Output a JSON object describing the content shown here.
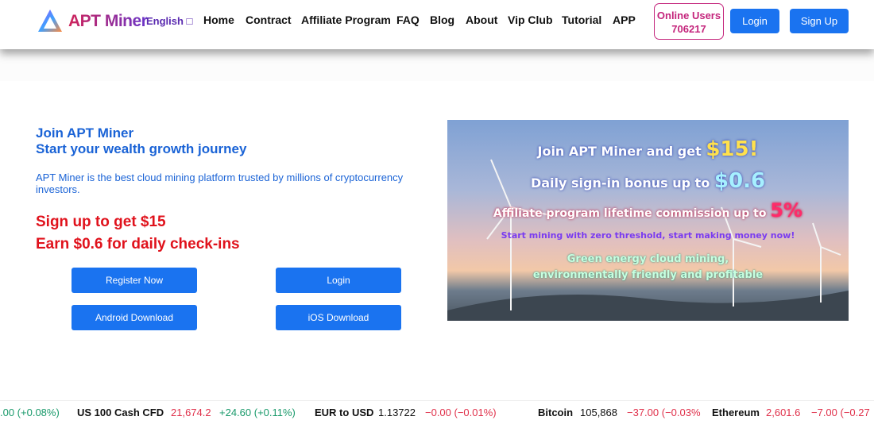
{
  "header": {
    "logo": "APT Miner",
    "language": "English □",
    "nav": [
      "Home",
      "Contract",
      "Affiliate Program",
      "FAQ",
      "Blog",
      "About",
      "Vip Club",
      "Tutorial",
      "APP"
    ],
    "online_label": "Online Users",
    "online_count": "706217",
    "login": "Login",
    "signup": "Sign Up"
  },
  "hero": {
    "title1": "Join APT Miner",
    "title2": "Start your wealth growth journey",
    "description": "APT Miner is the best cloud mining platform trusted by millions of cryptocurrency investors.",
    "promo1": "Sign up to get $15",
    "promo2": "Earn $0.6 for daily check-ins",
    "buttons": {
      "register": "Register Now",
      "login": "Login",
      "android": "Android Download",
      "ios": "iOS Download"
    }
  },
  "banner": {
    "line1": "Join APT Miner and get",
    "line1_amount": "$15!",
    "line2": "Daily sign-in bonus up to",
    "line2_amount": "$0.6",
    "line3": "Affiliate program lifetime commission up to",
    "line3_amount": "5%",
    "line4": "Start mining with zero threshold, start making money now!",
    "line5": "Green energy cloud mining,",
    "line6": "environmentally friendly and profitable"
  },
  "ticker": [
    {
      "name": "",
      "price": "",
      "change": ".00 (+0.08%)",
      "dir": "up"
    },
    {
      "name": "US 100 Cash CFD",
      "price": "21,674.2",
      "change": "+24.60 (+0.11%)",
      "dir": "up"
    },
    {
      "name": "EUR to USD",
      "price": "1.13722",
      "change": "−0.00 (−0.01%)",
      "dir": "down"
    },
    {
      "name": "Bitcoin",
      "price": "105,868",
      "change": "−37.00 (−0.03%",
      "dir": "down"
    },
    {
      "name": "Ethereum",
      "price": "2,601.6",
      "change": "−7.00 (−0.27",
      "dir": "down"
    }
  ],
  "colors": {
    "accent": "#1a73f0",
    "promo": "#e0121c",
    "online": "#c4257c",
    "up": "#1a9a6b",
    "down": "#e0314b"
  }
}
